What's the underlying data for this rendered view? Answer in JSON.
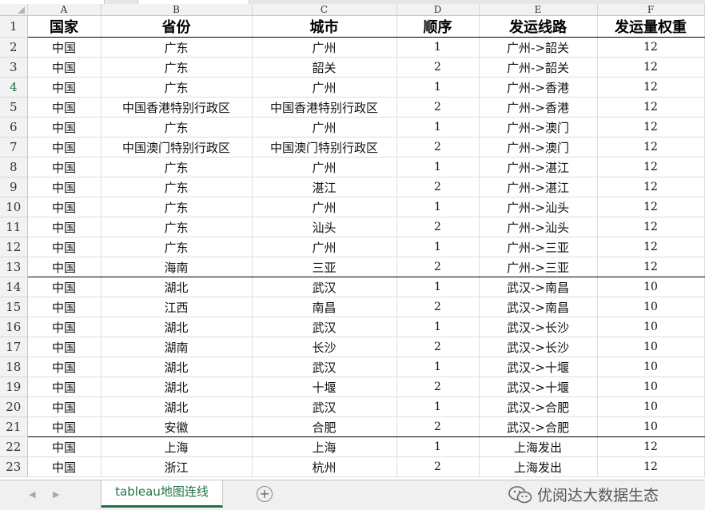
{
  "columns": [
    "A",
    "B",
    "C",
    "D",
    "E",
    "F"
  ],
  "header": {
    "row_num": "1",
    "cells": [
      "国家",
      "省份",
      "城市",
      "顺序",
      "发运线路",
      "发运量权重"
    ]
  },
  "rows": [
    {
      "n": "2",
      "cells": [
        "中国",
        "广东",
        "广州",
        "1",
        "广州->韶关",
        "12"
      ]
    },
    {
      "n": "3",
      "cells": [
        "中国",
        "广东",
        "韶关",
        "2",
        "广州->韶关",
        "12"
      ]
    },
    {
      "n": "4",
      "cells": [
        "中国",
        "广东",
        "广州",
        "1",
        "广州->香港",
        "12"
      ]
    },
    {
      "n": "5",
      "cells": [
        "中国",
        "中国香港特别行政区",
        "中国香港特别行政区",
        "2",
        "广州->香港",
        "12"
      ]
    },
    {
      "n": "6",
      "cells": [
        "中国",
        "广东",
        "广州",
        "1",
        "广州->澳门",
        "12"
      ]
    },
    {
      "n": "7",
      "cells": [
        "中国",
        "中国澳门特别行政区",
        "中国澳门特别行政区",
        "2",
        "广州->澳门",
        "12"
      ]
    },
    {
      "n": "8",
      "cells": [
        "中国",
        "广东",
        "广州",
        "1",
        "广州->湛江",
        "12"
      ]
    },
    {
      "n": "9",
      "cells": [
        "中国",
        "广东",
        "湛江",
        "2",
        "广州->湛江",
        "12"
      ]
    },
    {
      "n": "10",
      "cells": [
        "中国",
        "广东",
        "广州",
        "1",
        "广州->汕头",
        "12"
      ]
    },
    {
      "n": "11",
      "cells": [
        "中国",
        "广东",
        "汕头",
        "2",
        "广州->汕头",
        "12"
      ]
    },
    {
      "n": "12",
      "cells": [
        "中国",
        "广东",
        "广州",
        "1",
        "广州->三亚",
        "12"
      ]
    },
    {
      "n": "13",
      "cells": [
        "中国",
        "海南",
        "三亚",
        "2",
        "广州->三亚",
        "12"
      ]
    },
    {
      "n": "14",
      "cells": [
        "中国",
        "湖北",
        "武汉",
        "1",
        "武汉->南昌",
        "10"
      ]
    },
    {
      "n": "15",
      "cells": [
        "中国",
        "江西",
        "南昌",
        "2",
        "武汉->南昌",
        "10"
      ]
    },
    {
      "n": "16",
      "cells": [
        "中国",
        "湖北",
        "武汉",
        "1",
        "武汉->长沙",
        "10"
      ]
    },
    {
      "n": "17",
      "cells": [
        "中国",
        "湖南",
        "长沙",
        "2",
        "武汉->长沙",
        "10"
      ]
    },
    {
      "n": "18",
      "cells": [
        "中国",
        "湖北",
        "武汉",
        "1",
        "武汉->十堰",
        "10"
      ]
    },
    {
      "n": "19",
      "cells": [
        "中国",
        "湖北",
        "十堰",
        "2",
        "武汉->十堰",
        "10"
      ]
    },
    {
      "n": "20",
      "cells": [
        "中国",
        "湖北",
        "武汉",
        "1",
        "武汉->合肥",
        "10"
      ]
    },
    {
      "n": "21",
      "cells": [
        "中国",
        "安徽",
        "合肥",
        "2",
        "武汉->合肥",
        "10"
      ]
    },
    {
      "n": "22",
      "cells": [
        "中国",
        "上海",
        "上海",
        "1",
        "上海发出",
        "12"
      ]
    },
    {
      "n": "23",
      "cells": [
        "中国",
        "浙江",
        "杭州",
        "2",
        "上海发出",
        "12"
      ]
    }
  ],
  "selected_row": "4",
  "group_end_rows": [
    "13",
    "21"
  ],
  "sheet_tab": {
    "label": "tableau地图连线"
  },
  "nav": {
    "prev_icon": "chevron-left-icon",
    "next_icon": "chevron-right-icon",
    "add_icon": "plus-circle-icon"
  },
  "watermark": {
    "text": "优阅达大数据生态"
  },
  "colors": {
    "accent": "#217346",
    "grid": "#dedede",
    "header_bg": "#f2f2f2"
  }
}
